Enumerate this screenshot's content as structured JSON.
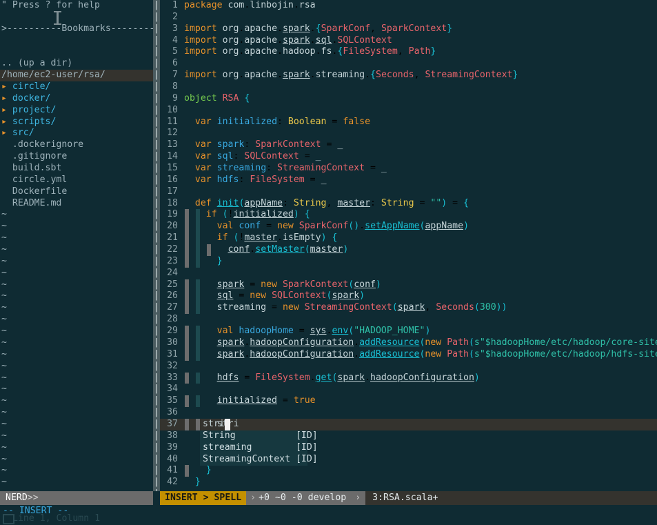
{
  "app": {
    "name": "vim",
    "colors": {
      "background": "#0f2b33",
      "accent_keyword": "#e8922a",
      "accent_type": "#e8646b",
      "accent_string": "#2fc0a8",
      "accent_punct": "#19bfd3",
      "status_mode_bg": "#c39000",
      "popup_bg": "#16383f",
      "cursorline_bg": "#34332e"
    }
  },
  "tree": {
    "help_hint": "\" Press ? for help",
    "bookmarks_header": ">----------Bookmarks----------",
    "up_a_dir": ".. (up a dir)",
    "cwd": "/home/ec2-user/rsa/",
    "dirs": [
      {
        "arrow": "▸",
        "label": "circle/"
      },
      {
        "arrow": "▸",
        "label": "docker/"
      },
      {
        "arrow": "▸",
        "label": "project/"
      },
      {
        "arrow": "▸",
        "label": "scripts/"
      },
      {
        "arrow": "▸",
        "label": "src/"
      }
    ],
    "files": [
      ".dockerignore",
      ".gitignore",
      "build.sbt",
      "circle.yml",
      "Dockerfile",
      "README.md"
    ],
    "empty_marker": "~",
    "empty_rows": 24
  },
  "editor": {
    "first_line_number": 1,
    "total_lines": 42,
    "lines": [
      {
        "n": 1,
        "text": "package com.linbojin.rsa"
      },
      {
        "n": 2,
        "text": ""
      },
      {
        "n": 3,
        "text": "import org.apache.spark.{SparkConf, SparkContext}"
      },
      {
        "n": 4,
        "text": "import org.apache.spark.sql.SQLContext"
      },
      {
        "n": 5,
        "text": "import org.apache.hadoop.fs.{FileSystem, Path}"
      },
      {
        "n": 6,
        "text": ""
      },
      {
        "n": 7,
        "text": "import org.apache.spark.streaming.{Seconds, StreamingContext}"
      },
      {
        "n": 8,
        "text": ""
      },
      {
        "n": 9,
        "text": "object RSA {"
      },
      {
        "n": 10,
        "text": ""
      },
      {
        "n": 11,
        "text": "  var initialized: Boolean = false"
      },
      {
        "n": 12,
        "text": ""
      },
      {
        "n": 13,
        "text": "  var spark: SparkContext = _"
      },
      {
        "n": 14,
        "text": "  var sql: SQLContext = _"
      },
      {
        "n": 15,
        "text": "  var streaming: StreamingContext = _"
      },
      {
        "n": 16,
        "text": "  var hdfs: FileSystem = _"
      },
      {
        "n": 17,
        "text": ""
      },
      {
        "n": 18,
        "text": "  def init(appName: String, master: String = \"\") = {"
      },
      {
        "n": 19,
        "text": "    if (!initialized) {"
      },
      {
        "n": 20,
        "text": "      val conf = new SparkConf().setAppName(appName)"
      },
      {
        "n": 21,
        "text": "      if (!master.isEmpty) {"
      },
      {
        "n": 22,
        "text": "        conf.setMaster(master)"
      },
      {
        "n": 23,
        "text": "      }"
      },
      {
        "n": 24,
        "text": ""
      },
      {
        "n": 25,
        "text": "      spark = new SparkContext(conf)"
      },
      {
        "n": 26,
        "text": "      sql = new SQLContext(spark)"
      },
      {
        "n": 27,
        "text": "      streaming = new StreamingContext(spark, Seconds(300))"
      },
      {
        "n": 28,
        "text": ""
      },
      {
        "n": 29,
        "text": "      val hadoopHome = sys.env(\"HADOOP_HOME\")"
      },
      {
        "n": 30,
        "text": "      spark.hadoopConfiguration.addResource(new Path(s\"$hadoopHome/etc/hadoop/core-site.xml\"))"
      },
      {
        "n": 31,
        "text": "      spark.hadoopConfiguration.addResource(new Path(s\"$hadoopHome/etc/hadoop/hdfs-site.xml\"))"
      },
      {
        "n": 32,
        "text": ""
      },
      {
        "n": 33,
        "text": "      hdfs = FileSystem.get(spark.hadoopConfiguration)"
      },
      {
        "n": 34,
        "text": ""
      },
      {
        "n": 35,
        "text": "      initialized = true"
      },
      {
        "n": 36,
        "text": ""
      },
      {
        "n": 37,
        "text": "      stri"
      },
      {
        "n": 38,
        "text": ""
      },
      {
        "n": 39,
        "text": ""
      },
      {
        "n": 40,
        "text": ""
      },
      {
        "n": 41,
        "text": "    }"
      },
      {
        "n": 42,
        "text": "  }"
      }
    ]
  },
  "completion_popup": {
    "typed_prefix": "stri",
    "items": [
      {
        "word": "String",
        "kind": "[ID]"
      },
      {
        "word": "streaming",
        "kind": "[ID]"
      },
      {
        "word": "StreamingContext",
        "kind": "[ID]"
      }
    ]
  },
  "statusbar": {
    "tree_label": "NERD",
    "tree_chevron": ">>",
    "mode": "INSERT > SPELL",
    "branch_sep": "›",
    "git_added": "+0",
    "git_modified": "~0",
    "git_removed": "-0",
    "branch": "develop",
    "arrow": "›",
    "file": "3:RSA.scala+"
  },
  "cmdline": {
    "message": "-- INSERT --",
    "ghost_message": "Line 1, Column 1"
  }
}
